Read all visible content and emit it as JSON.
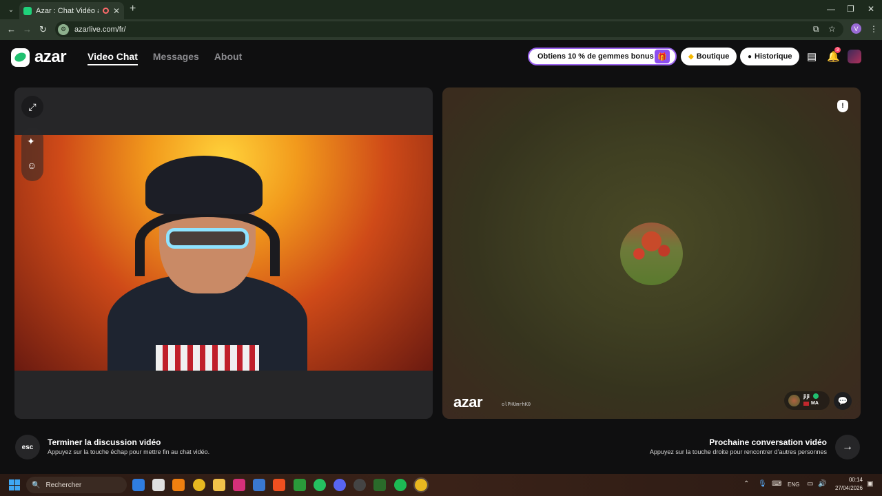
{
  "browser": {
    "tab_title": "Azar : Chat Vidéo avec de",
    "tab_close": "✕",
    "new_tab": "+",
    "url": "azarlive.com/fr/",
    "profile_initial": "V"
  },
  "header": {
    "logo_text": "azar",
    "nav": [
      {
        "label": "Video Chat",
        "active": true
      },
      {
        "label": "Messages",
        "active": false
      },
      {
        "label": "About",
        "active": false
      }
    ],
    "promo_label": "Obtiens 10 % de gemmes bonus !",
    "shop_label": "Boutique",
    "history_label": "Historique",
    "notification_count": "3"
  },
  "remote": {
    "watermark": "azar",
    "user_id": "olPHUmrhK0",
    "partner_name": "jiji",
    "partner_country": "MA"
  },
  "footer": {
    "esc_key": "esc",
    "end_title": "Terminer la discussion vidéo",
    "end_sub": "Appuyez sur la touche échap pour mettre fin au chat vidéo.",
    "next_title": "Prochaine conversation vidéo",
    "next_sub": "Appuyez sur la touche droite pour rencontrer d’autres personnes",
    "next_key": "→"
  },
  "taskbar": {
    "search_placeholder": "Rechercher",
    "lang": "ENG",
    "time": "00:14",
    "date": "27/04/2026"
  },
  "colors": {
    "accent_green": "#20c070",
    "promo_border": "#9b62f0",
    "badge_red": "#ff4d6d"
  }
}
